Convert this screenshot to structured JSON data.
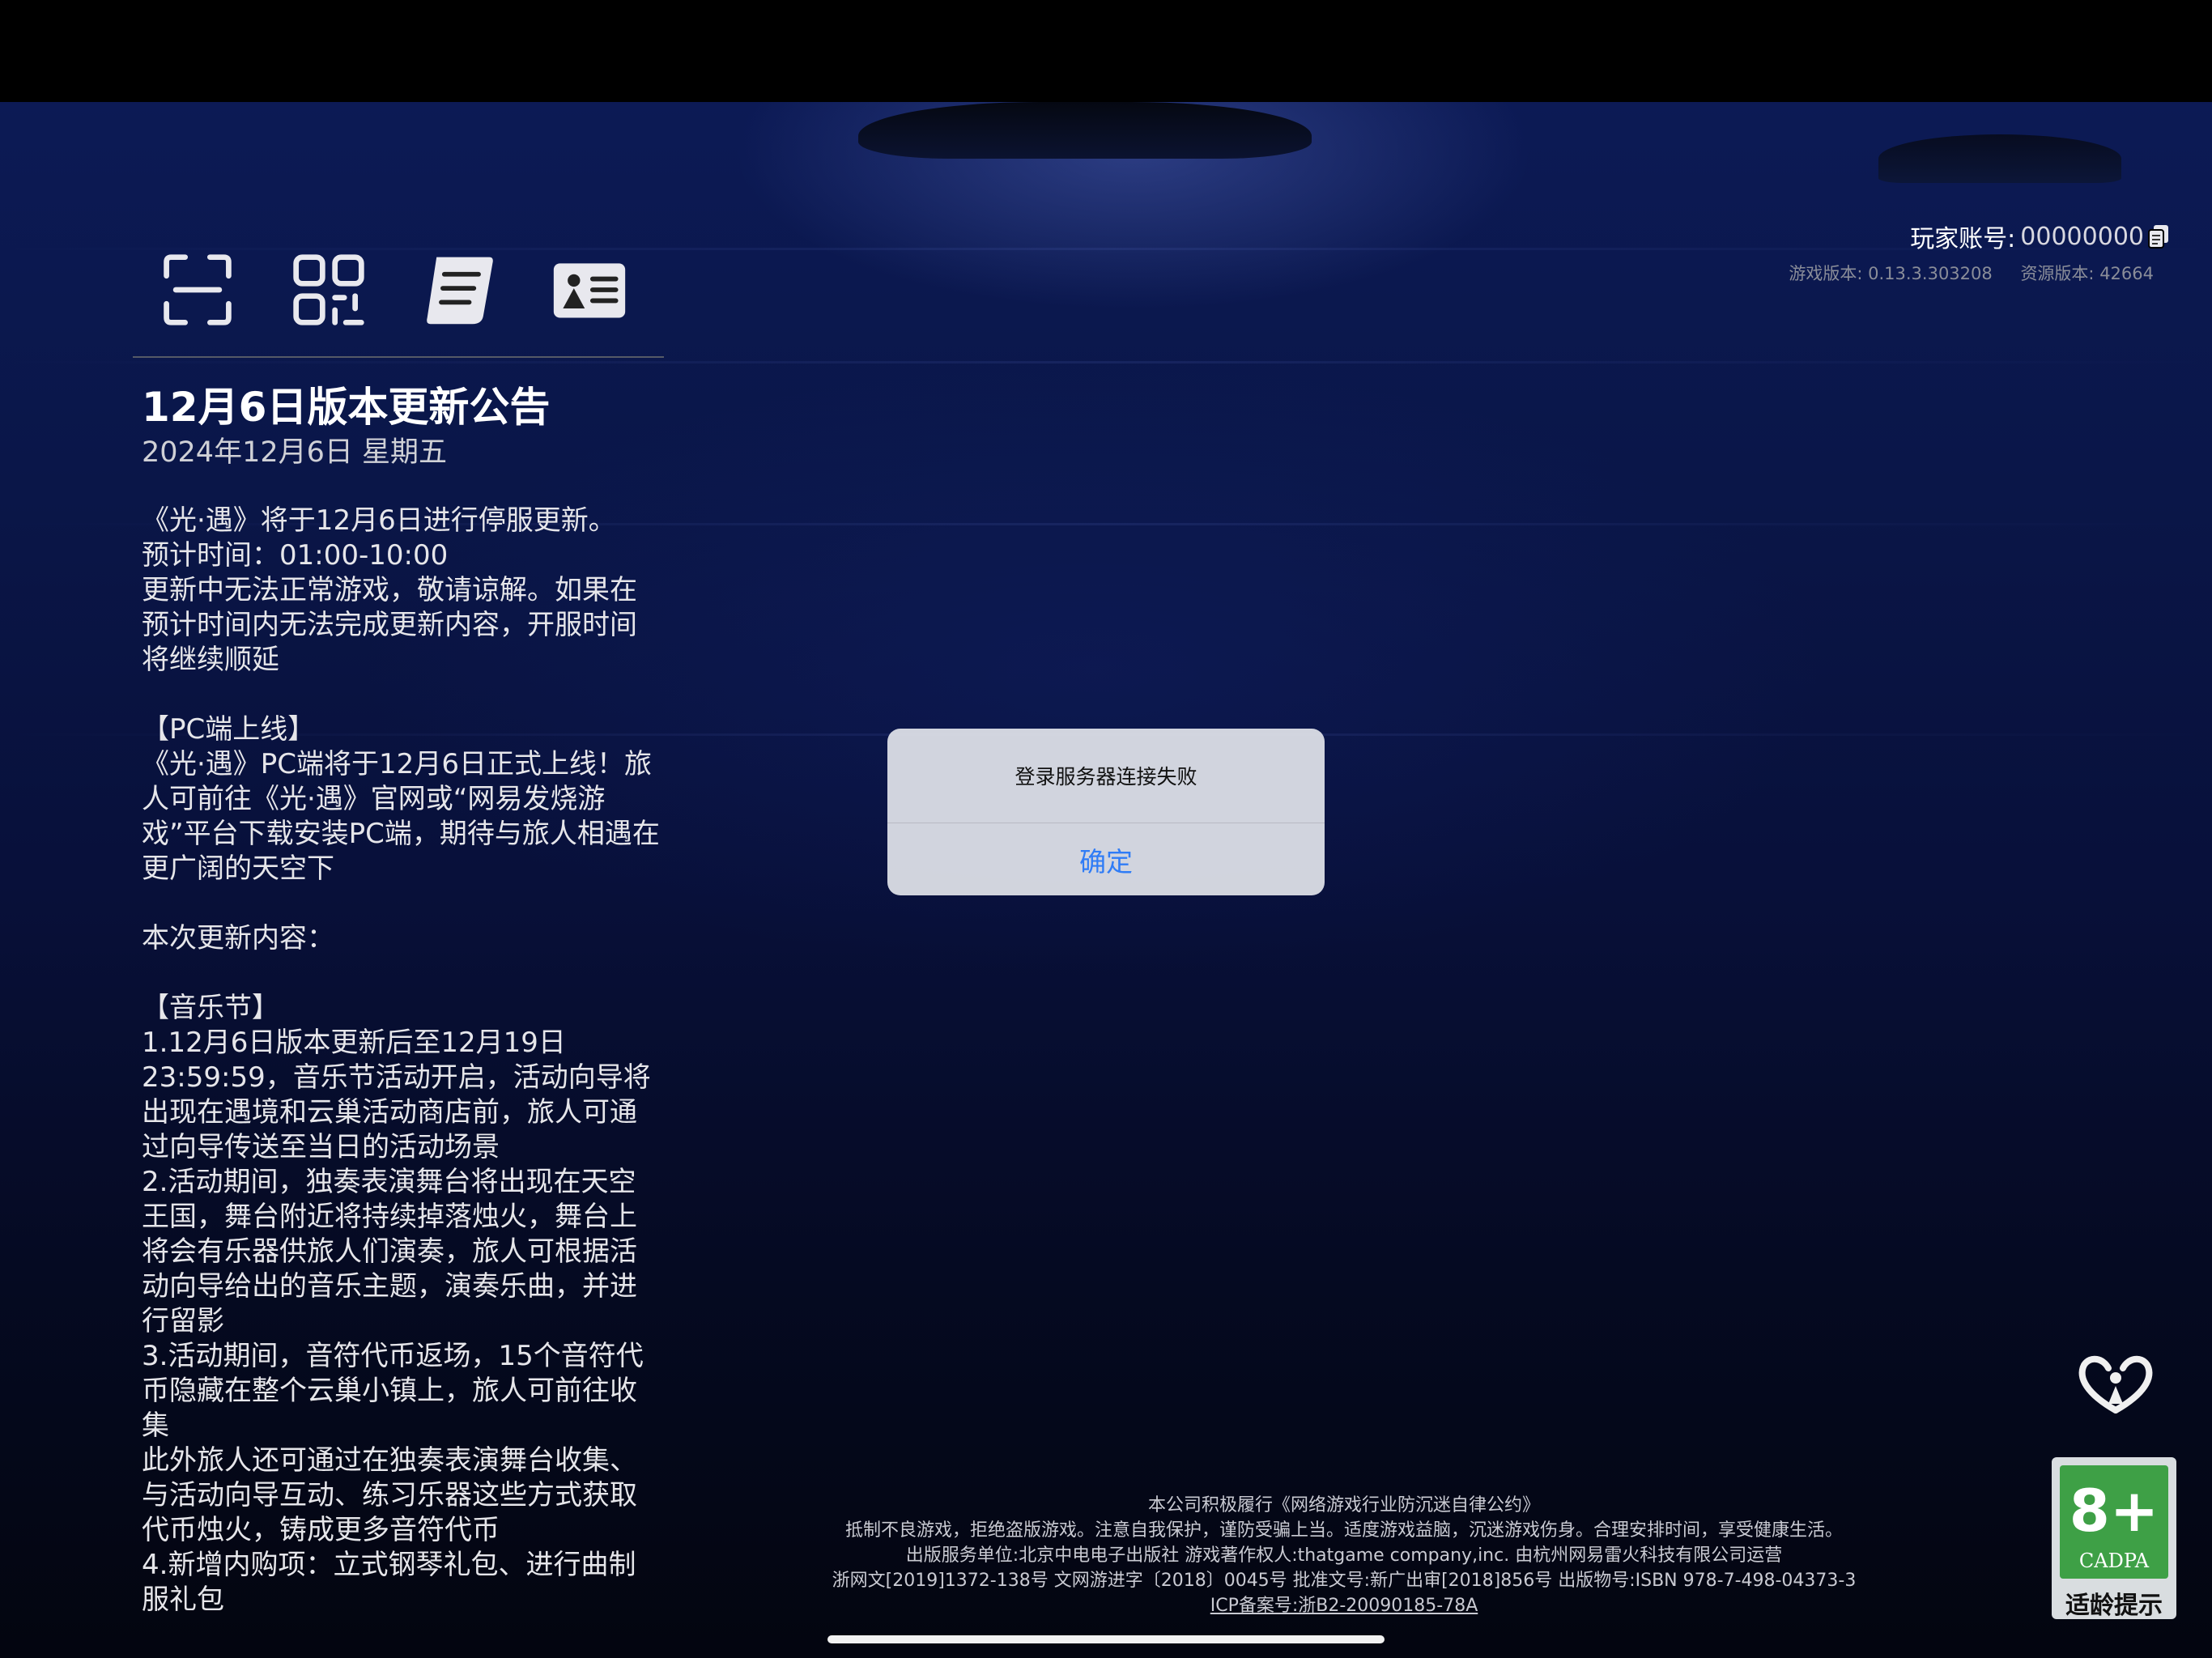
{
  "announcement": {
    "title": "12月6日版本更新公告",
    "date": "2024年12月6日 星期五",
    "body": "《光·遇》将于12月6日进行停服更新。\n预计时间：01:00-10:00\n更新中无法正常游戏，敬请谅解。如果在预计时间内无法完成更新内容，开服时间将继续顺延\n\n【PC端上线】\n《光·遇》PC端将于12月6日正式上线！旅人可前往《光·遇》官网或“网易发烧游戏”平台下载安装PC端，期待与旅人相遇在更广阔的天空下\n\n本次更新内容：\n\n【音乐节】\n1.12月6日版本更新后至12月19日23:59:59，音乐节活动开启，活动向导将出现在遇境和云巢活动商店前，旅人可通过向导传送至当日的活动场景\n2.活动期间，独奏表演舞台将出现在天空王国，舞台附近将持续掉落烛火，舞台上将会有乐器供旅人们演奏，旅人可根据活动向导给出的音乐主题，演奏乐曲，并进行留影\n3.活动期间，音符代币返场，15个音符代币隐藏在整个云巢小镇上，旅人可前往收集\n此外旅人还可通过在独奏表演舞台收集、与活动向导互动、练习乐器这些方式获取代币烛火，铸成更多音符代币\n4.新增内购项：立式钢琴礼包、进行曲制服礼包"
  },
  "toolbar": {
    "icons": [
      "scan-icon",
      "qr-code-icon",
      "scroll-icon",
      "id-card-icon"
    ]
  },
  "account": {
    "label": "玩家账号:",
    "value": "00000000"
  },
  "versions": {
    "game": "游戏版本: 0.13.3.303208",
    "resource": "资源版本: 42664"
  },
  "dialog": {
    "message": "登录服务器连接失败",
    "confirm": "确定",
    "confirm_color": "#2f7cf6"
  },
  "footer": {
    "line1": "本公司积极履行《网络游戏行业防沉迷自律公约》",
    "line2": "抵制不良游戏，拒绝盗版游戏。注意自我保护，谨防受骗上当。适度游戏益脑，沉迷游戏伤身。合理安排时间，享受健康生活。",
    "line3": "出版服务单位:北京中电电子出版社 游戏著作权人:thatgame company,inc. 由杭州网易雷火科技有限公司运营",
    "line4": "浙网文[2019]1372-138号 文网游进字〔2018〕0045号 批准文号:新广出审[2018]856号 出版物号:ISBN 978-7-498-04373-3",
    "icp": "ICP备案号:浙B2-20090185-78A"
  },
  "age_rating": {
    "number": "8+",
    "brand": "CADPA",
    "label": "适龄提示",
    "color": "#3ea046"
  }
}
